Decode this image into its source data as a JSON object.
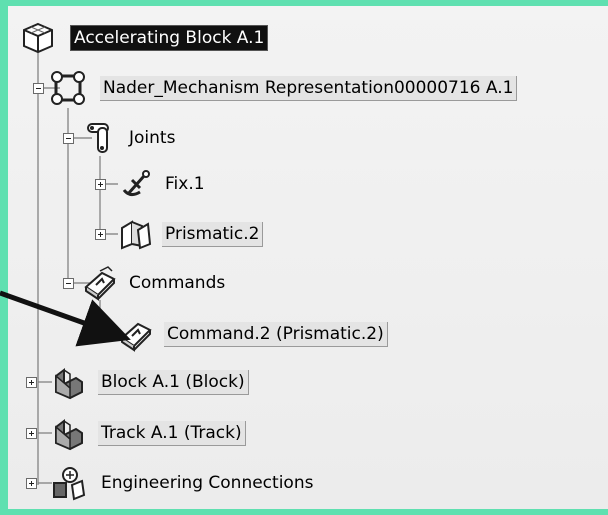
{
  "tree": {
    "root": {
      "label": "Accelerating Block A.1",
      "icon": "product-root-icon"
    },
    "mechanism": {
      "label": "Nader_Mechanism Representation00000716 A.1",
      "icon": "mechanism-icon"
    },
    "joints": {
      "label": "Joints",
      "icon": "joints-icon"
    },
    "fix": {
      "label": "Fix.1",
      "icon": "anchor-fix-icon"
    },
    "prismatic": {
      "label": "Prismatic.2",
      "icon": "prismatic-joint-icon"
    },
    "commands": {
      "label": "Commands",
      "icon": "commands-icon"
    },
    "command2": {
      "label": "Command.2 (Prismatic.2)",
      "icon": "command-icon"
    },
    "block": {
      "label": "Block A.1 (Block)",
      "icon": "part-block-icon"
    },
    "track": {
      "label": "Track A.1 (Track)",
      "icon": "part-track-icon"
    },
    "engineering": {
      "label": "Engineering Connections",
      "icon": "engineering-connections-icon"
    }
  },
  "colors": {
    "background": "#5fe0b0",
    "selected_bg": "#101010",
    "arrow": "#111111"
  }
}
